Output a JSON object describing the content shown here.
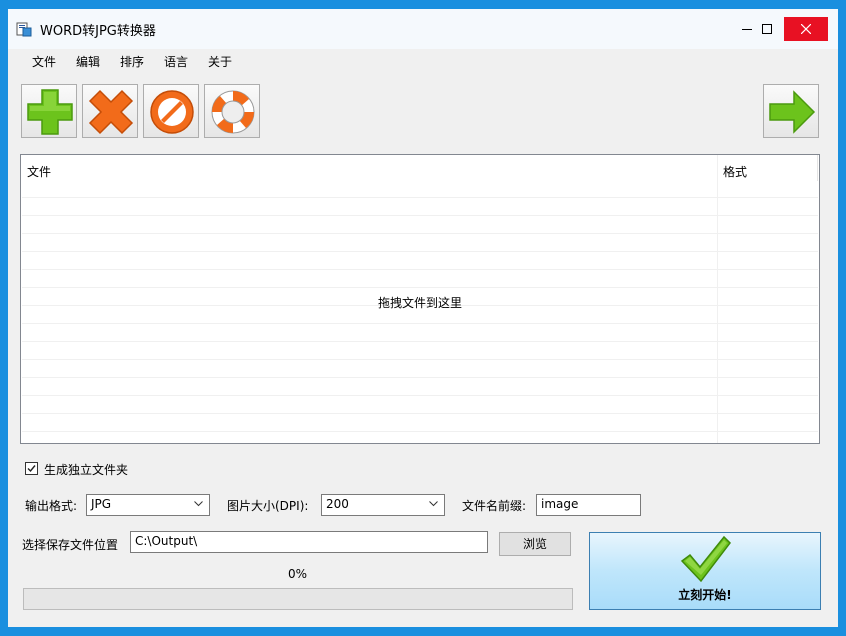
{
  "window": {
    "title": "WORD转JPG转换器"
  },
  "menu": [
    "文件",
    "编辑",
    "排序",
    "语言",
    "关于"
  ],
  "toolbar": {
    "add": "plus-icon",
    "remove": "x-icon",
    "clear": "prohibit-icon",
    "help": "lifebuoy-icon",
    "next": "arrow-right-icon"
  },
  "file_list": {
    "columns": [
      "文件",
      "格式"
    ],
    "empty_text": "拖拽文件到这里",
    "rows": []
  },
  "options": {
    "separate_folder_label": "生成独立文件夹",
    "separate_folder_checked": true,
    "output_format_label": "输出格式:",
    "output_format_value": "JPG",
    "dpi_label": "图片大小(DPI):",
    "dpi_value": "200",
    "prefix_label": "文件名前缀:",
    "prefix_value": "image"
  },
  "output": {
    "save_location_label": "选择保存文件位置",
    "path_value": "C:\\Output\\",
    "browse_label": "浏览"
  },
  "progress": {
    "percent_text": "0%",
    "value": 0
  },
  "start": {
    "label": "立刻开始!"
  },
  "colors": {
    "accent": "#1a8fdf",
    "close": "#e81123",
    "green": "#6cc31c",
    "orange": "#f26b1a"
  }
}
